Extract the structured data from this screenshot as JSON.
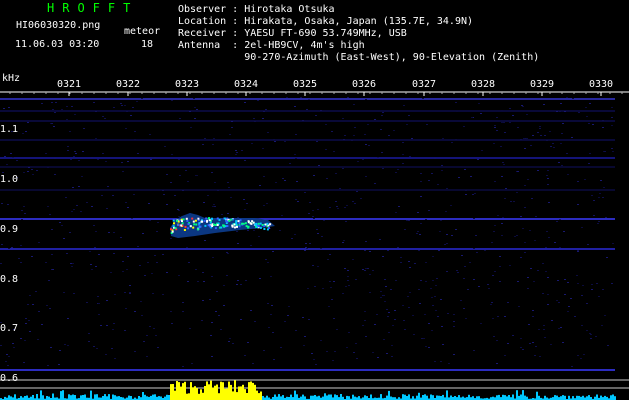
{
  "app": {
    "title": "HROFFT"
  },
  "file": {
    "name": "HI06030320.png",
    "datetime": "11.06.03 03:20"
  },
  "meteor": {
    "label": "meteor",
    "count": "18"
  },
  "station": {
    "observer": "Observer : Hirotaka Otsuka",
    "location": "Location : Hirakata, Osaka, Japan (135.7E, 34.9N)",
    "receiver": "Receiver : YAESU FT-690 53.749MHz, USB",
    "antenna": "Antenna  : 2el-HB9CV, 4m's high",
    "antenna_detail": "           90-270-Azimuth (East-West), 90-Elevation (Zenith)"
  },
  "axes": {
    "unit": "kHz",
    "time_ticks": [
      "0321",
      "0322",
      "0323",
      "0324",
      "0325",
      "0326",
      "0327",
      "0328",
      "0329",
      "0330"
    ],
    "freq_ticks": [
      "1.1",
      "1.0",
      "0.9",
      "0.8",
      "0.7",
      "0.6"
    ]
  },
  "colors": {
    "background": "#000000",
    "title": "#00ff00",
    "grid": "#1a1a8c",
    "bright_line": "#3b3bff",
    "bars": "#00c8ff",
    "bars_highlight": "#ffff00"
  }
}
